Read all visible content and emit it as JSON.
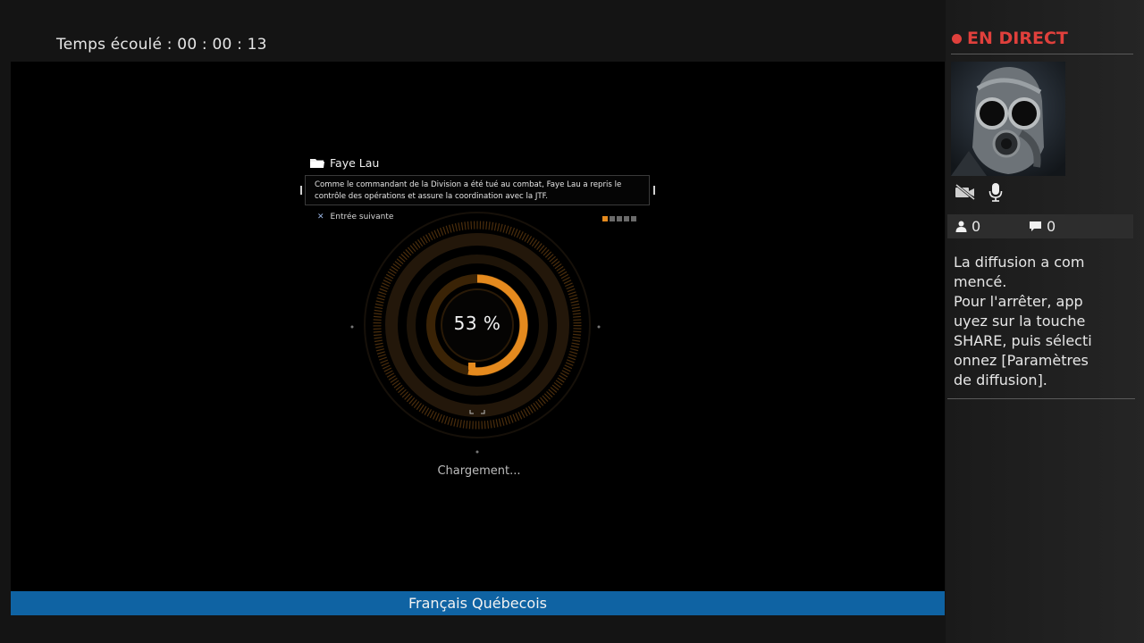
{
  "elapsed": {
    "label": "Temps écoulé",
    "separator": ":",
    "time": "00 : 00 : 13"
  },
  "game": {
    "entry": {
      "title": "Faye Lau",
      "text_line1": "Comme le commandant de la Division a été tué au combat, Faye Lau a repris le",
      "text_line2": "contrôle des opérations et assure la coordination avec la JTF.",
      "next_label": "Entrée suivante",
      "next_icon": "cross-button-icon",
      "pages_total": 5,
      "page_current": 1
    },
    "loading": {
      "percent_text": "53 %",
      "progress": 0.53,
      "label": "Chargement..."
    },
    "accent_color": "#e58a1e"
  },
  "language_bar": {
    "label": "Français Québecois",
    "color": "#0f63a3"
  },
  "sidebar": {
    "live_label": "EN DIRECT",
    "live_color": "#e0403c",
    "avatar_icon": "gas-mask-avatar",
    "camera_icon": "camera-off-icon",
    "mic_icon": "microphone-icon",
    "viewers": "0",
    "comments": "0",
    "message_lines": [
      "La diffusion a com",
      "mencé.",
      "Pour l'arrêter, app",
      "uyez sur la touche",
      "SHARE, puis sélecti",
      "onnez [Paramètres",
      "de diffusion]."
    ]
  }
}
